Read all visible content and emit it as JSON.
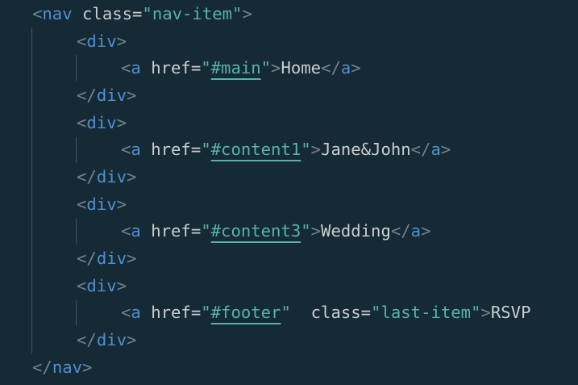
{
  "colors": {
    "background": "#162a35",
    "punctuation": "#6f848f",
    "tag": "#4f8fd0",
    "attribute": "#c8cdd0",
    "string": "#57b3a5",
    "text": "#c8cdd0",
    "indent_guide": "#3e5560"
  },
  "code": {
    "nav_open": {
      "lt": "<",
      "tag": "nav",
      "attr": "class",
      "eq": "=",
      "q1": "\"",
      "value": "nav-item",
      "q2": "\"",
      "gt": ">"
    },
    "div_open": {
      "lt": "<",
      "tag": "div",
      "gt": ">"
    },
    "div_close": {
      "lt": "</",
      "tag": "div",
      "gt": ">"
    },
    "a_close": {
      "lt": "</",
      "tag": "a",
      "gt": ">"
    },
    "links": [
      {
        "lt": "<",
        "tag": "a",
        "attr": "href",
        "eq": "=",
        "q1": "\"",
        "value": "#main",
        "q2": "\"",
        "gt": ">",
        "text": "Home"
      },
      {
        "lt": "<",
        "tag": "a",
        "attr": "href",
        "eq": "=",
        "q1": "\"",
        "value": "#content1",
        "q2": "\"",
        "gt": ">",
        "text": "Jane&John"
      },
      {
        "lt": "<",
        "tag": "a",
        "attr": "href",
        "eq": "=",
        "q1": "\"",
        "value": "#content3",
        "q2": "\"",
        "gt": ">",
        "text": "Wedding"
      },
      {
        "lt": "<",
        "tag": "a",
        "attr": "href",
        "eq": "=",
        "q1": "\"",
        "value": "#footer",
        "q2": "\"",
        "gt": ">",
        "text": "RSVP",
        "attr2": "class",
        "eq2": "=",
        "q3": "\"",
        "value2": "last-item",
        "q4": "\""
      }
    ],
    "nav_close": {
      "lt": "</",
      "tag": "nav",
      "gt": ">"
    }
  }
}
